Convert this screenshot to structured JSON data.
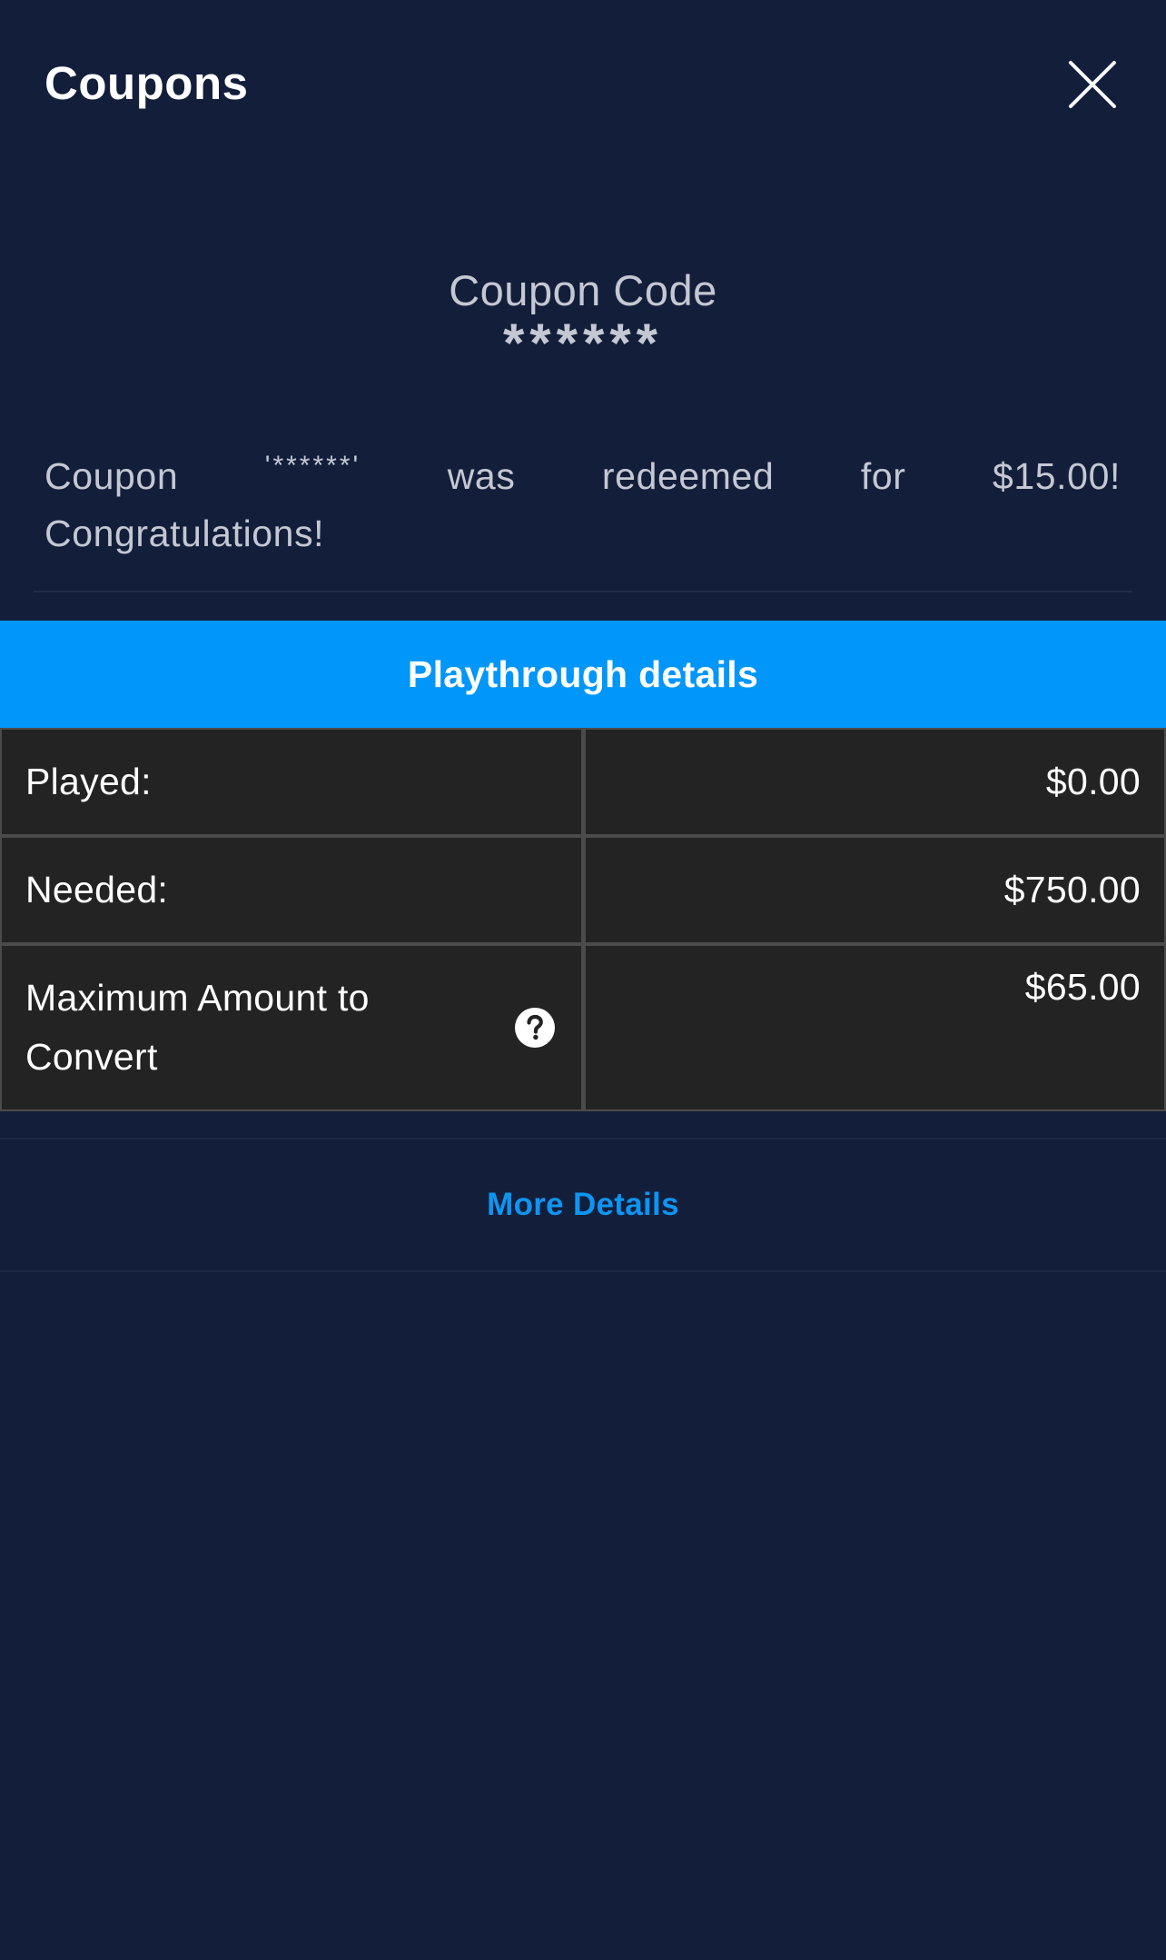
{
  "header": {
    "title": "Coupons",
    "close_icon": "close-icon"
  },
  "coupon": {
    "code_label": "Coupon Code",
    "code_value": "******",
    "message_words": [
      "Coupon",
      "'******'",
      "was",
      "redeemed",
      "for",
      "$15.00!"
    ],
    "message_line2": "Congratulations!"
  },
  "playthrough": {
    "header": "Playthrough details",
    "rows": [
      {
        "label": "Played:",
        "value": "$0.00"
      },
      {
        "label": "Needed:",
        "value": "$750.00"
      },
      {
        "label": "Maximum Amount to Convert",
        "value": "$65.00",
        "help_icon": "question-circle-icon"
      }
    ]
  },
  "more_details_label": "More Details",
  "colors": {
    "background": "#131e3b",
    "accent": "#0096fa",
    "link": "#0d95f2",
    "table_cell": "#232323",
    "table_border": "#4b4b4b"
  }
}
